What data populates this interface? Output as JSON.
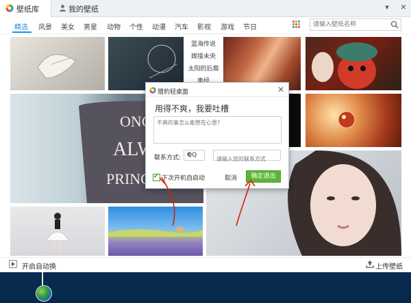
{
  "app": {
    "title": "壁纸库",
    "my_wallpapers": "我的壁纸"
  },
  "window_controls": {
    "menu": "▾",
    "minimize": "—",
    "close": "✕"
  },
  "categories": [
    "精选",
    "风景",
    "美女",
    "男星",
    "动物",
    "个性",
    "动漫",
    "汽车",
    "影视",
    "游戏",
    "节日"
  ],
  "active_category": "精选",
  "search": {
    "placeholder": "请输入壁纸名称"
  },
  "dropdown": {
    "items": [
      "蓝海传说",
      "嫁接未央",
      "太阳的后裔",
      "奥经"
    ]
  },
  "bottom": {
    "auto_change": "开启自动换",
    "upload": "上传壁纸"
  },
  "dialog": {
    "title": "猎豹轻桌面",
    "heading": "用得不爽，我要吐槽",
    "textarea_placeholder": "不爽的事怎么能憋在心里?",
    "contact_label": "联系方式:",
    "contact_type": "QQ",
    "contact_placeholder": "请输入您的联系方式",
    "checkbox_label": "下次开机自启动",
    "checkbox_checked": true,
    "cancel": "取消",
    "confirm": "确定退出"
  },
  "colors": {
    "accent": "#1a8fd8",
    "confirm_green": "#5cb536",
    "annotation_red": "#d81e06"
  }
}
